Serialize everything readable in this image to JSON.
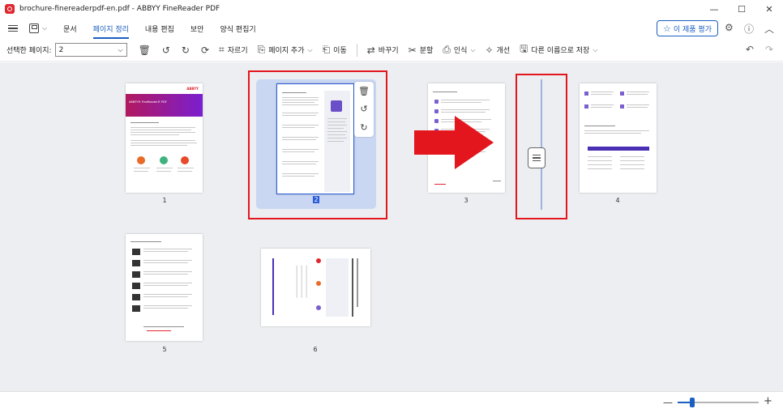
{
  "window": {
    "title": "brochure-finereaderpdf-en.pdf - ABBYY FineReader PDF",
    "minimize": "—",
    "maximize": "☐",
    "close": "✕"
  },
  "menu": {
    "items": [
      "문서",
      "페이지 정리",
      "내용 편집",
      "보안",
      "양식 편집기"
    ],
    "active": "페이지 정리",
    "rate_label": "이 제품 평가"
  },
  "toolbar": {
    "selected_pages_label": "선택한 페이지:",
    "selected_pages_value": "2",
    "crop": "자르기",
    "add_page": "페이지 추가",
    "move": "이동",
    "replace": "바꾸기",
    "split": "분할",
    "recognize": "인식",
    "improve": "개선",
    "save_as": "다른 이름으로 저장"
  },
  "pages": [
    {
      "number": "1"
    },
    {
      "number": "2",
      "selected": true
    },
    {
      "number": "3"
    },
    {
      "number": "4"
    },
    {
      "number": "5"
    },
    {
      "number": "6"
    }
  ],
  "page_content": {
    "p1_brand": "ABBYY",
    "p1_title": "ABBYY® FineReader® PDF"
  },
  "zoom": {
    "level": 0.18
  },
  "colors": {
    "accent": "#1b5fc1",
    "highlight_red": "#e3161d",
    "selection": "#c9d7f3"
  }
}
